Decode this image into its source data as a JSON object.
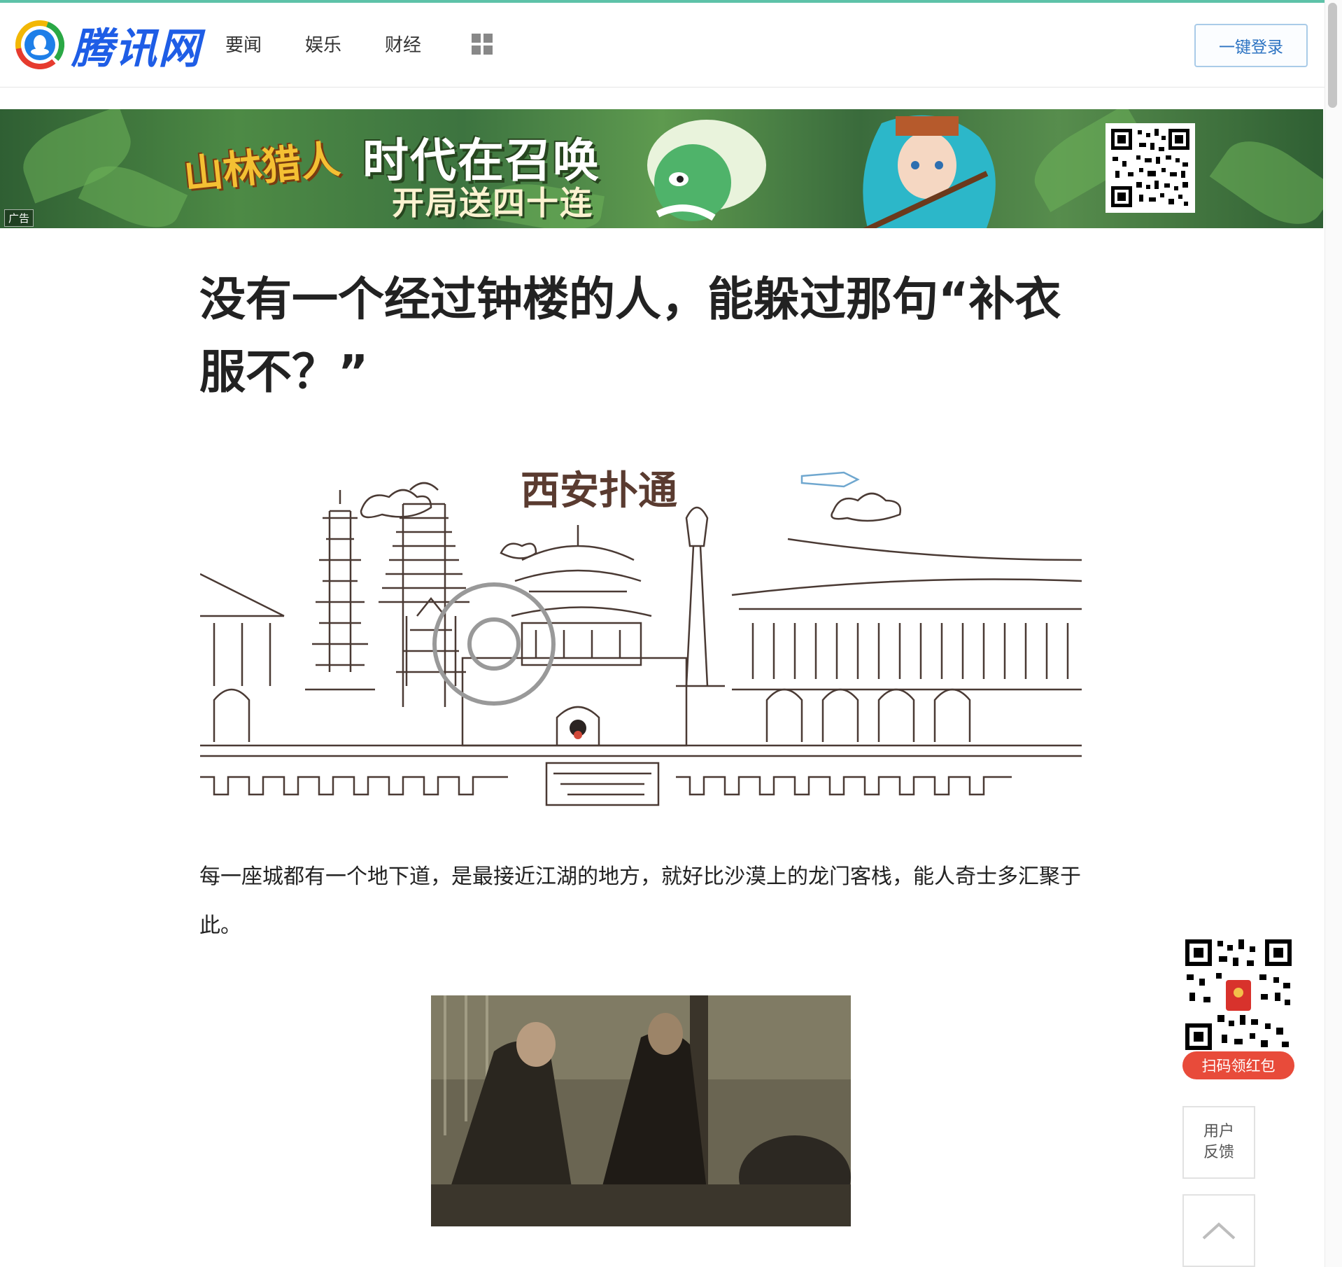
{
  "header": {
    "logo_text": "腾讯网",
    "nav": [
      "要闻",
      "娱乐",
      "财经"
    ],
    "login_label": "一键登录"
  },
  "banner": {
    "ad_label": "广告",
    "game_name": "山林猎人",
    "slogan_main": "时代在召唤",
    "slogan_sub": "开局送四十连"
  },
  "article": {
    "title": "没有一个经过钟楼的人，能躲过那句“补衣服不？”",
    "illustration_title": "西安扑通",
    "paragraph": "每一座城都有一个地下道，是最接近江湖的地方，就好比沙漠上的龙门客栈，能人奇士多汇聚于此。"
  },
  "sidebar": {
    "redpack_label": "扫码领红包",
    "feedback_line1": "用户",
    "feedback_line2": "反馈"
  },
  "colors": {
    "accent_line": "#5dc2a8",
    "logo_blue": "#1e5de6",
    "login_border": "#a9cbe8",
    "redpack": "#e84b3a"
  },
  "icons": [
    "tencent-logo-icon",
    "grid-menu-icon",
    "qr-code-icon",
    "chevron-up-icon"
  ]
}
